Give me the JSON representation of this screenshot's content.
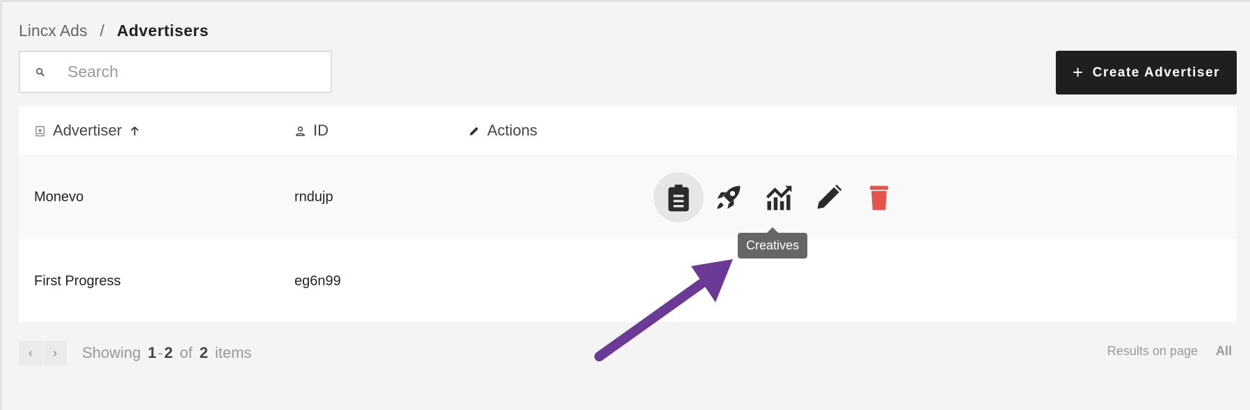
{
  "breadcrumb": {
    "root": "Lincx Ads",
    "separator": "/",
    "current": "Advertisers"
  },
  "search": {
    "placeholder": "Search",
    "value": ""
  },
  "create_button": {
    "label": "Create Advertiser"
  },
  "table": {
    "columns": [
      {
        "label": "Advertiser",
        "sorted": "ascending"
      },
      {
        "label": "ID"
      },
      {
        "label": "Actions"
      }
    ],
    "rows": [
      {
        "advertiser": "Monevo",
        "id": "rndujp"
      },
      {
        "advertiser": "First Progress",
        "id": "eg6n99"
      }
    ]
  },
  "tooltip": {
    "text": "Creatives"
  },
  "pagination": {
    "showing": "Showing",
    "range_start": "1",
    "range_sep": "-",
    "range_end": "2",
    "of": "of",
    "total": "2",
    "items": "items",
    "results_label": "Results on page",
    "results_value": "All"
  },
  "colors": {
    "delete": "#e5534b",
    "annotation_arrow": "#6a3a96",
    "button": "#1f1f1f"
  }
}
